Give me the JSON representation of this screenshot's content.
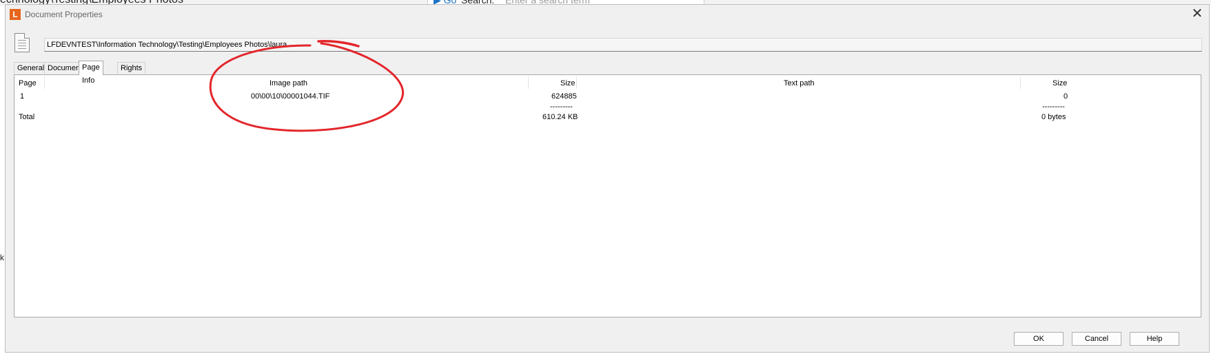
{
  "background": {
    "breadcrumb_fragment": "echnology\\Testing\\Employees Photos",
    "go_label": "Go",
    "search_label": "Search:",
    "search_placeholder": "Enter a search term",
    "left_fragment": "k"
  },
  "dialog": {
    "app_letter": "L",
    "title": "Document Properties",
    "path": "LFDEVNTEST\\Information Technology\\Testing\\Employees Photos\\laura",
    "tabs": [
      {
        "label": "General",
        "active": false
      },
      {
        "label": "Document",
        "active": false
      },
      {
        "label": "Page Info",
        "active": true
      },
      {
        "label": "Rights",
        "active": false
      }
    ],
    "page_info": {
      "columns": [
        "Page",
        "Image path",
        "Size",
        "Text path",
        "Size"
      ],
      "rows": [
        {
          "page": "1",
          "image_path": "00\\00\\10\\00001044.TIF",
          "image_size": "624885",
          "text_path": "",
          "text_size": "0"
        }
      ],
      "separator": "---------",
      "total": {
        "label": "Total",
        "image_size": "610.24 KB",
        "text_size": "0 bytes"
      }
    },
    "buttons": {
      "ok": "OK",
      "cancel": "Cancel",
      "help": "Help"
    }
  },
  "colors": {
    "accent": "#e5661c",
    "annotation": "#e3262b"
  }
}
